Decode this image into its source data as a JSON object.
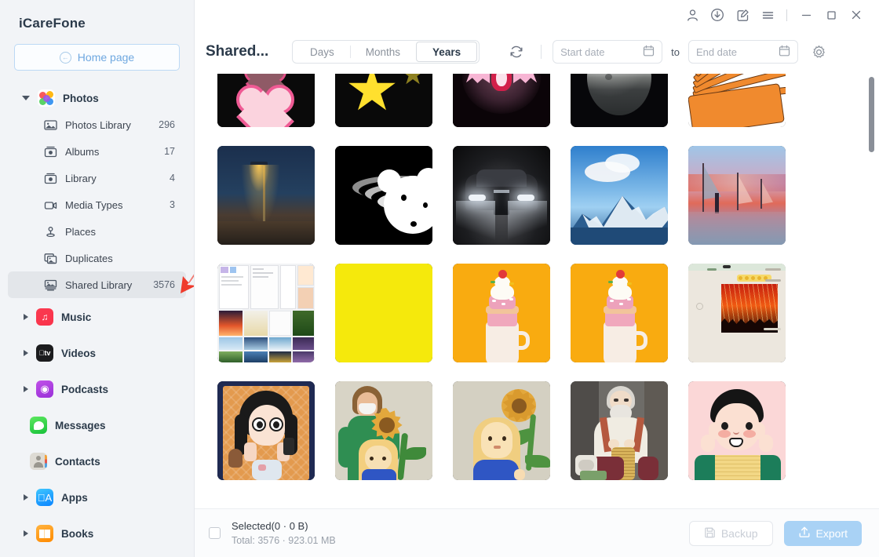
{
  "app": {
    "brand": "iCareFone",
    "home_button": "Home page"
  },
  "titlebar": {
    "icons": [
      {
        "name": "account-icon",
        "label": "Account"
      },
      {
        "name": "download-icon",
        "label": "Download"
      },
      {
        "name": "feedback-icon",
        "label": "Feedback"
      },
      {
        "name": "menu-icon",
        "label": "Menu"
      }
    ],
    "minimize": "Minimize",
    "maximize": "Maximize",
    "close": "Close"
  },
  "sidebar": {
    "groups": [
      {
        "label": "Photos",
        "icon": "photos-app-icon",
        "expanded": true,
        "items": [
          {
            "label": "Photos Library",
            "count": "296",
            "icon": "image-icon"
          },
          {
            "label": "Albums",
            "count": "17",
            "icon": "album-icon"
          },
          {
            "label": "Library",
            "count": "4",
            "icon": "album-icon"
          },
          {
            "label": "Media Types",
            "count": "3",
            "icon": "video-camera-icon"
          },
          {
            "label": "Places",
            "count": "",
            "icon": "pin-icon"
          },
          {
            "label": "Duplicates",
            "count": "",
            "icon": "duplicate-icon"
          },
          {
            "label": "Shared Library",
            "count": "3576",
            "icon": "shared-library-icon",
            "selected": true
          }
        ]
      },
      {
        "label": "Music",
        "icon": "music-app-icon",
        "expanded": false,
        "items": []
      },
      {
        "label": "Videos",
        "icon": "appletv-app-icon",
        "expanded": false,
        "items": []
      },
      {
        "label": "Podcasts",
        "icon": "podcasts-app-icon",
        "expanded": false,
        "items": []
      },
      {
        "label": "Messages",
        "icon": "messages-app-icon",
        "expanded": null,
        "items": []
      },
      {
        "label": "Contacts",
        "icon": "contacts-app-icon",
        "expanded": null,
        "items": []
      },
      {
        "label": "Apps",
        "icon": "appstore-app-icon",
        "expanded": false,
        "items": []
      },
      {
        "label": "Books",
        "icon": "books-app-icon",
        "expanded": false,
        "items": []
      }
    ]
  },
  "toolbar": {
    "title": "Shared...",
    "segments": [
      {
        "label": "Days",
        "selected": false
      },
      {
        "label": "Months",
        "selected": false
      },
      {
        "label": "Years",
        "selected": true
      }
    ],
    "refresh_icon": "refresh-icon",
    "start_date_placeholder": "Start date",
    "to_label": "to",
    "end_date_placeholder": "End date",
    "calendar_icon": "calendar-icon",
    "settings_icon": "gear-icon"
  },
  "grid": {
    "columns": 5,
    "photos": [
      {
        "name": "pink-hearts-on-black",
        "style": "heartimg"
      },
      {
        "name": "yellow-stars-on-black",
        "style": "starimg"
      },
      {
        "name": "pink-bat-glow",
        "style": "batimg"
      },
      {
        "name": "moon",
        "style": "moonimg"
      },
      {
        "name": "orange-card-fan",
        "style": "fanimg"
      },
      {
        "name": "street-lamp-at-night",
        "style": "lampimg"
      },
      {
        "name": "black-white-bear-pattern",
        "style": "bearimg"
      },
      {
        "name": "luxury-car-headlights",
        "style": "carimg"
      },
      {
        "name": "snowy-mountain",
        "style": "mtnimg"
      },
      {
        "name": "sunset-beach-sailboats",
        "style": "sunsetimg"
      },
      {
        "name": "desktop-screenshot-collage",
        "style": "shotimg"
      },
      {
        "name": "solid-yellow",
        "style": "yellowimg"
      },
      {
        "name": "cupcake-milkshake-orange",
        "style": "shakeimg"
      },
      {
        "name": "cupcake-milkshake-orange-duplicate",
        "style": "shakeimg"
      },
      {
        "name": "chat-screenshot-concert",
        "style": "chatimg"
      },
      {
        "name": "illustration-girl-with-phone",
        "style": "girlimg"
      },
      {
        "name": "illustration-family-sunflowers",
        "style": "sunfamimg"
      },
      {
        "name": "illustration-girl-sunflower",
        "style": "sungirlimg"
      },
      {
        "name": "illustration-old-man-knitting",
        "style": "oldmanimg"
      },
      {
        "name": "illustration-worried-boy",
        "style": "boyimg"
      }
    ]
  },
  "footer": {
    "selected_label": "Selected(0 · 0 B)",
    "total_label": "Total: 3576 · 923.01 MB",
    "backup_button": "Backup",
    "export_button": "Export",
    "backup_icon": "save-icon",
    "export_icon": "upload-icon"
  },
  "colors": {
    "accent": "#a9d2f5",
    "sidebar_bg": "#f2f4f7",
    "selected_row": "#e3e6ea",
    "annotation_arrow": "#ef3b2d"
  }
}
